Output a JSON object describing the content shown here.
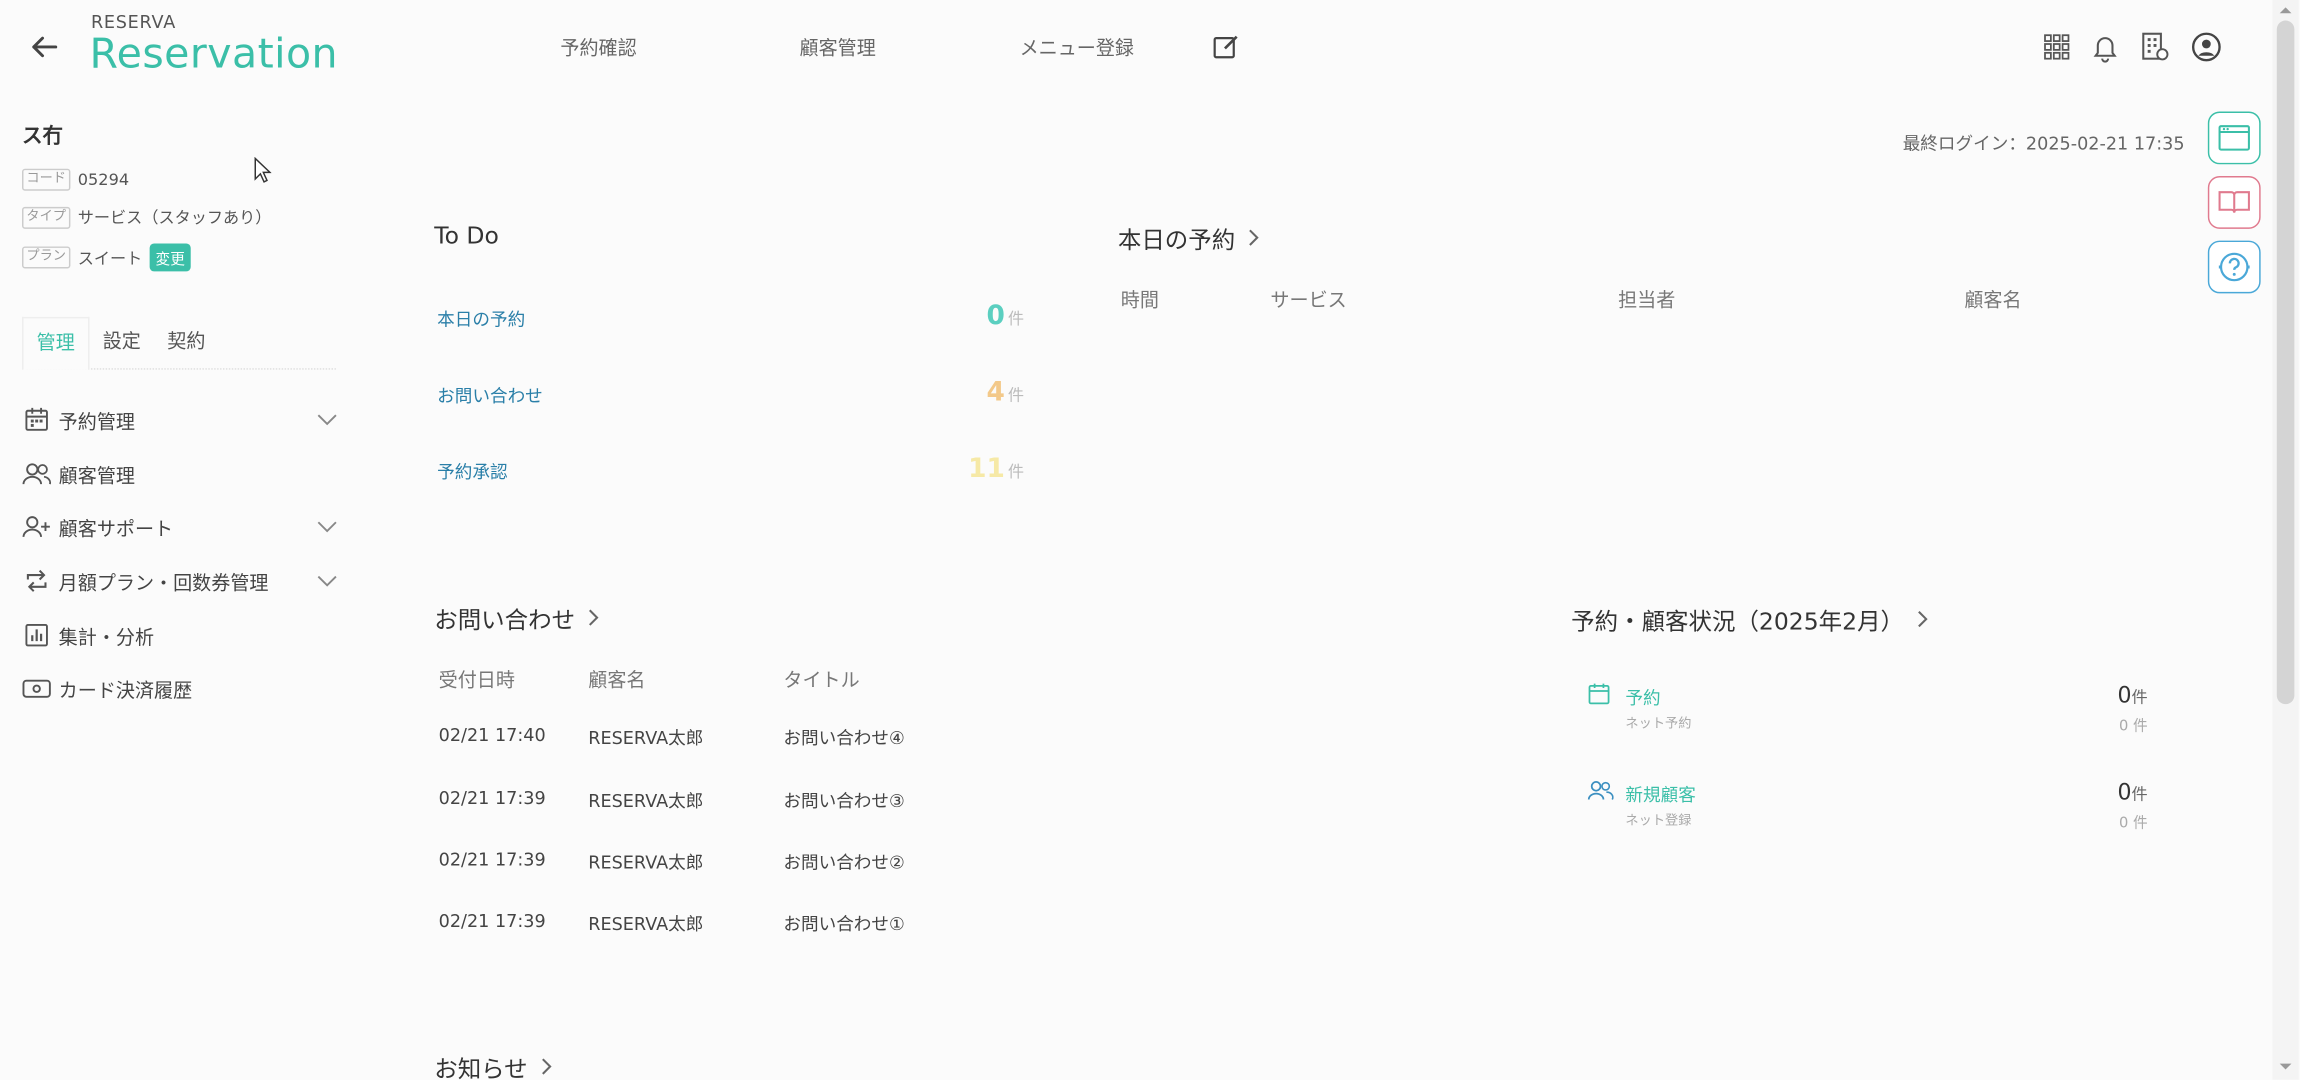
{
  "header": {
    "back_icon": "arrow-left-icon",
    "logo_small": "RESERVA",
    "logo_big": "Reservation",
    "nav": [
      "予約確認",
      "顧客管理",
      "メニュー登録"
    ],
    "icons": [
      "edit-icon",
      "apps-grid-icon",
      "bell-icon",
      "settings-building-icon",
      "account-icon"
    ]
  },
  "sidebar": {
    "shop_name": "ス冇",
    "code_tag": "コード",
    "code": "05294",
    "type_tag": "タイプ",
    "type": "サービス（スタッフあり）",
    "plan_tag": "プラン",
    "plan": "スイート",
    "change_label": "変更",
    "tabs": [
      "管理",
      "設定",
      "契約"
    ],
    "active_tab": "管理",
    "items": [
      {
        "label": "予約管理",
        "icon": "calendar-icon",
        "expandable": true
      },
      {
        "label": "顧客管理",
        "icon": "users-icon",
        "expandable": false
      },
      {
        "label": "顧客サポート",
        "icon": "user-plus-icon",
        "expandable": true
      },
      {
        "label": "月額プラン・回数券管理",
        "icon": "repeat-icon",
        "expandable": true
      },
      {
        "label": "集計・分析",
        "icon": "bar-chart-icon",
        "expandable": false
      },
      {
        "label": "カード決済履歴",
        "icon": "card-icon",
        "expandable": false
      }
    ]
  },
  "login": {
    "text": "最終ログイン：2025-02-21 17:35"
  },
  "todo": {
    "title": "To Do",
    "items": [
      {
        "label": "本日の予約",
        "count": "0",
        "unit": "件",
        "color": "#5bcfc0"
      },
      {
        "label": "お問い合わせ",
        "count": "4",
        "unit": "件",
        "color": "#f3c98a"
      },
      {
        "label": "予約承認",
        "count": "11",
        "unit": "件",
        "color": "#f6e9a6"
      }
    ]
  },
  "today": {
    "title": "本日の予約",
    "columns": [
      "時間",
      "サービス",
      "担当者",
      "顧客名"
    ]
  },
  "inquiries": {
    "title": "お問い合わせ",
    "columns": [
      "受付日時",
      "顧客名",
      "タイトル"
    ],
    "rows": [
      {
        "date": "02/21 17:40",
        "name": "RESERVA太郎",
        "title": "お問い合わせ④"
      },
      {
        "date": "02/21 17:39",
        "name": "RESERVA太郎",
        "title": "お問い合わせ③"
      },
      {
        "date": "02/21 17:39",
        "name": "RESERVA太郎",
        "title": "お問い合わせ②"
      },
      {
        "date": "02/21 17:39",
        "name": "RESERVA太郎",
        "title": "お問い合わせ①"
      }
    ]
  },
  "status": {
    "title": "予約・顧客状況（2025年2月）",
    "items": [
      {
        "label": "予約",
        "sub": "ネット予約",
        "count": "0",
        "unit": "件",
        "subcount": "0 件",
        "icon": "calendar-icon"
      },
      {
        "label": "新規顧客",
        "sub": "ネット登録",
        "count": "0",
        "unit": "件",
        "subcount": "0 件",
        "icon": "users-icon"
      }
    ]
  },
  "news": {
    "title": "お知らせ"
  },
  "float_buttons": [
    {
      "icon": "browser-window-icon",
      "color": "#3bbfa8"
    },
    {
      "icon": "book-icon",
      "color": "#e07a8e"
    },
    {
      "icon": "help-headset-icon",
      "color": "#4aa8d8"
    }
  ]
}
